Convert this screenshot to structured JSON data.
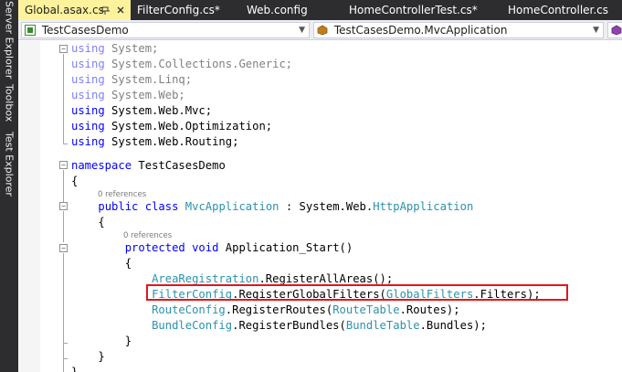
{
  "sidebar": {
    "tabs": [
      "Server Explorer",
      "Toolbox",
      "Test Explorer"
    ]
  },
  "tabs": [
    {
      "label": "Global.asax.cs",
      "active": true
    },
    {
      "label": "FilterConfig.cs*",
      "active": false
    },
    {
      "label": "Web.config",
      "active": false
    },
    {
      "label": "HomeControllerTest.cs*",
      "active": false
    },
    {
      "label": "HomeController.cs",
      "active": false
    }
  ],
  "tab_icons": {
    "pin": "pin-icon",
    "close": "close-icon"
  },
  "navbar": {
    "project": "TestCasesDemo",
    "class": "TestCasesDemo.MvcApplication",
    "project_icon": "csharp-project-icon",
    "class_icon": "class-icon",
    "member_icon": "method-icon"
  },
  "code": {
    "using_lines": [
      {
        "kw": "using",
        "ns": "System;",
        "dim": true
      },
      {
        "kw": "using",
        "ns": "System.Collections.Generic;",
        "dim": true
      },
      {
        "kw": "using",
        "ns": "System.Linq;",
        "dim": true
      },
      {
        "kw": "using",
        "ns": "System.Web;",
        "dim": true
      },
      {
        "kw": "using",
        "ns": "System.Web.Mvc;",
        "dim": false
      },
      {
        "kw": "using",
        "ns": "System.Web.Optimization;",
        "dim": false
      },
      {
        "kw": "using",
        "ns": "System.Web.Routing;",
        "dim": false
      }
    ],
    "namespace_kw": "namespace",
    "namespace_name": "TestCasesDemo",
    "open_brace": "{",
    "close_brace": "}",
    "class_refs": "0 references",
    "class_decl": {
      "public": "public",
      "class": "class",
      "name": "MvcApplication",
      "colon": " : ",
      "base_ns": "System.Web.",
      "base": "HttpApplication"
    },
    "method_refs": "0 references",
    "method_decl": {
      "protected": "protected",
      "void": "void",
      "name": "Application_Start()"
    },
    "body": [
      {
        "type": "AreaRegistration",
        "rest": ".RegisterAllAreas();"
      },
      {
        "type": "FilterConfig",
        "mid": ".RegisterGlobalFilters(",
        "arg": "GlobalFilters",
        "end": ".Filters);"
      },
      {
        "type": "RouteConfig",
        "mid": ".RegisterRoutes(",
        "arg": "RouteTable",
        "end": ".Routes);"
      },
      {
        "type": "BundleConfig",
        "mid": ".RegisterBundles(",
        "arg": "BundleTable",
        "end": ".Bundles);"
      }
    ]
  },
  "colors": {
    "keyword": "#0000ff",
    "type": "#2b91af",
    "highlight_box": "#e1161b",
    "active_tab": "#fff29d",
    "chrome": "#2d2d30"
  }
}
